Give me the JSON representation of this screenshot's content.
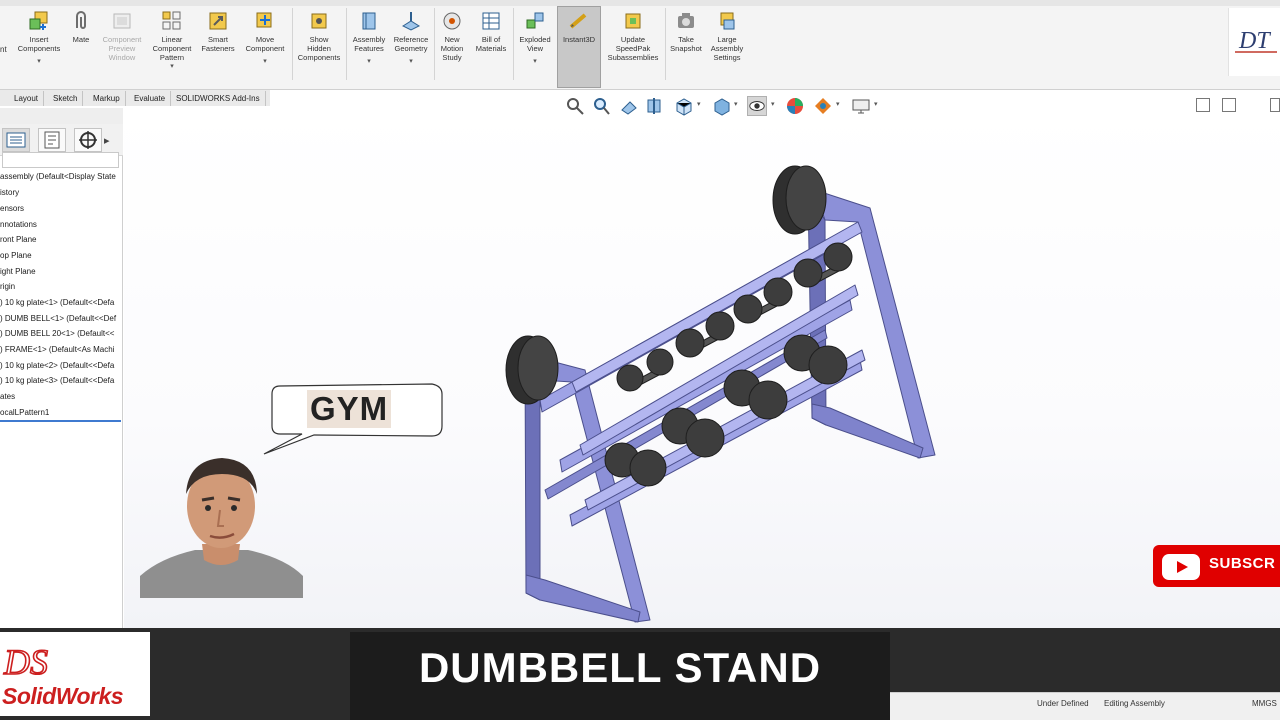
{
  "ribbon": {
    "buttons": [
      {
        "label": "Insert\nComponents",
        "has_dropdown": true
      },
      {
        "label": "Mate"
      },
      {
        "label": "Component\nPreview\nWindow",
        "disabled": true
      },
      {
        "label": "Linear\nComponent\nPattern",
        "has_dropdown": true
      },
      {
        "label": "Smart\nFasteners"
      },
      {
        "label": "Move\nComponent",
        "has_dropdown": true
      },
      {
        "label": "Show\nHidden\nComponents"
      },
      {
        "label": "Assembly\nFeatures",
        "has_dropdown": true
      },
      {
        "label": "Reference\nGeometry",
        "has_dropdown": true
      },
      {
        "label": "New\nMotion\nStudy"
      },
      {
        "label": "Bill of\nMaterials"
      },
      {
        "label": "Exploded\nView",
        "has_dropdown": true
      },
      {
        "label": "Instant3D",
        "active": true
      },
      {
        "label": "Update\nSpeedPak\nSubassemblies"
      },
      {
        "label": "Take\nSnapshot"
      },
      {
        "label": "Large\nAssembly\nSettings"
      }
    ],
    "left_fragment": "nt",
    "corner_logo_text": "DT"
  },
  "command_tabs": [
    "Layout",
    "Sketch",
    "Markup",
    "Evaluate",
    "SOLIDWORKS Add-Ins"
  ],
  "feature_tree": {
    "items": [
      "assembly  (Default<Display State",
      "istory",
      "ensors",
      "nnotations",
      "ront Plane",
      "op Plane",
      "ight Plane",
      "rigin",
      ") 10 kg plate<1> (Default<<Defa",
      ") DUMB BELL<1> (Default<<Def",
      ") DUMB BELL 20<1> (Default<<",
      ") FRAME<1> (Default<As Machi",
      ") 10 kg plate<2> (Default<<Defa",
      ") 10 kg plate<3> (Default<<Defa",
      "ates",
      "ocalLPattern1"
    ]
  },
  "viewport": {
    "bubble_text": "GYM",
    "model_name": "Dumbbell stand assembly",
    "colors": {
      "frame": "#8a8ed6",
      "frame_dark": "#5f63a8",
      "weights": "#3a3a3a"
    }
  },
  "overlay": {
    "subscribe_label": "SUBSCR",
    "title": "DUMBBELL STAND",
    "brand_logo": "SolidWorks",
    "brand_mark": "DS",
    "colors": {
      "subscribe": "#e00000",
      "banner": "#1c1c1c",
      "brand": "#cc1f1f"
    }
  },
  "status_bar": {
    "status": "Under Defined",
    "mode": "Editing Assembly",
    "units": "MMGS"
  }
}
